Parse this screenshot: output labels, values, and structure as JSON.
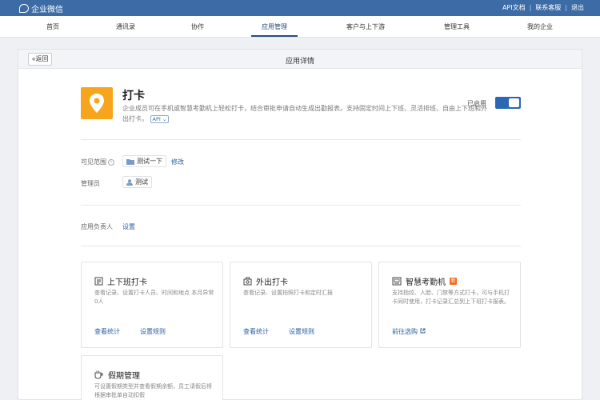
{
  "topbar": {
    "logo_text": "企业微信",
    "links": [
      "API文档",
      "联系客服",
      "退出"
    ],
    "separator": "|"
  },
  "nav": {
    "items": [
      "首页",
      "通讯录",
      "协作",
      "应用管理",
      "客户与上下游",
      "管理工具",
      "我的企业"
    ],
    "active": "应用管理"
  },
  "panel": {
    "back_label": "返回",
    "title": "应用详情"
  },
  "app": {
    "name": "打卡",
    "description": "企业成员可在手机或智慧考勤机上轻松打卡，结合审批申请自动生成出勤报表。支持固定时间上下班、灵活排班、自由上下班和外出打卡。",
    "api_tag": "API",
    "enabled_label": "已启用",
    "enabled": true,
    "icon": "location-pin-icon",
    "icon_color": "#f7a51c"
  },
  "visibility": {
    "label": "可见范围",
    "scope": "测试一下",
    "edit_label": "修改"
  },
  "admin": {
    "label": "管理员",
    "name": "测试"
  },
  "owner": {
    "label": "应用负责人",
    "action": "设置"
  },
  "cards": [
    {
      "title": "上下班打卡",
      "icon": "clipboard-icon",
      "description": "查看记录、设置打卡人员、时间和地点 本月异常0人",
      "links": [
        "查看统计",
        "设置规则"
      ]
    },
    {
      "title": "外出打卡",
      "icon": "camera-icon",
      "description": "查看记录、设置拍照打卡和定时汇报",
      "links": [
        "查看统计",
        "设置规则"
      ]
    },
    {
      "title": "智慧考勤机",
      "icon": "attendance-machine-icon",
      "badge": "新",
      "description": "支持指纹、人脸、门禁等方式打卡，可与手机打卡同时使用，打卡记录汇总到上下班打卡报表。",
      "links": [
        "前往选购"
      ]
    },
    {
      "title": "假期管理",
      "icon": "cup-icon",
      "description": "可设置假期类型并查看假期余额，员工请假后将根据审批单自动扣假",
      "links": []
    }
  ],
  "colors": {
    "topbar": "#3c6ba6",
    "accent": "#2c67b5",
    "link": "#2c5ea0",
    "badge": "#f26b1d"
  }
}
